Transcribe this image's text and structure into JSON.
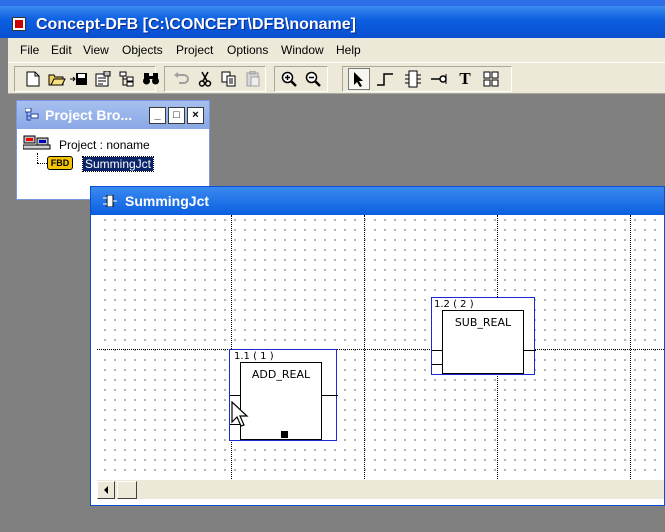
{
  "app": {
    "title": "Concept-DFB [C:\\CONCEPT\\DFB\\noname]",
    "accent_color": "#0b5ee0"
  },
  "menu": {
    "items": [
      "File",
      "Edit",
      "View",
      "Objects",
      "Project",
      "Options",
      "Window",
      "Help"
    ]
  },
  "toolbar": {
    "buttons": [
      {
        "icon": "new-file-icon"
      },
      {
        "icon": "open-folder-icon"
      },
      {
        "icon": "save-icon"
      },
      {
        "icon": "properties-icon"
      },
      {
        "icon": "project-tree-icon"
      },
      {
        "icon": "find-binoculars-icon"
      },
      {
        "icon": "undo-icon",
        "state": "disabled"
      },
      {
        "icon": "cut-icon"
      },
      {
        "icon": "copy-icon"
      },
      {
        "icon": "paste-icon",
        "state": "disabled"
      },
      {
        "icon": "zoom-in-icon"
      },
      {
        "icon": "zoom-out-icon"
      },
      {
        "icon": "select-pointer-icon",
        "state": "pressed"
      },
      {
        "icon": "link-icon"
      },
      {
        "icon": "function-block-icon"
      },
      {
        "icon": "pin-icon"
      },
      {
        "icon": "text-icon",
        "glyph": "T"
      },
      {
        "icon": "grid-icon"
      }
    ]
  },
  "project_browser": {
    "title": "Project Bro...",
    "window_buttons": [
      "_",
      "□",
      "×"
    ],
    "tree": {
      "project_label": "Project : noname",
      "dfb_badge": "FBD",
      "dfb_name": "SummingJct"
    }
  },
  "editor": {
    "title": "SummingJct",
    "blocks": [
      {
        "id": "1.1 ( 1 )",
        "type": "ADD_REAL"
      },
      {
        "id": "1.2 ( 2 )",
        "type": "SUB_REAL"
      }
    ]
  }
}
